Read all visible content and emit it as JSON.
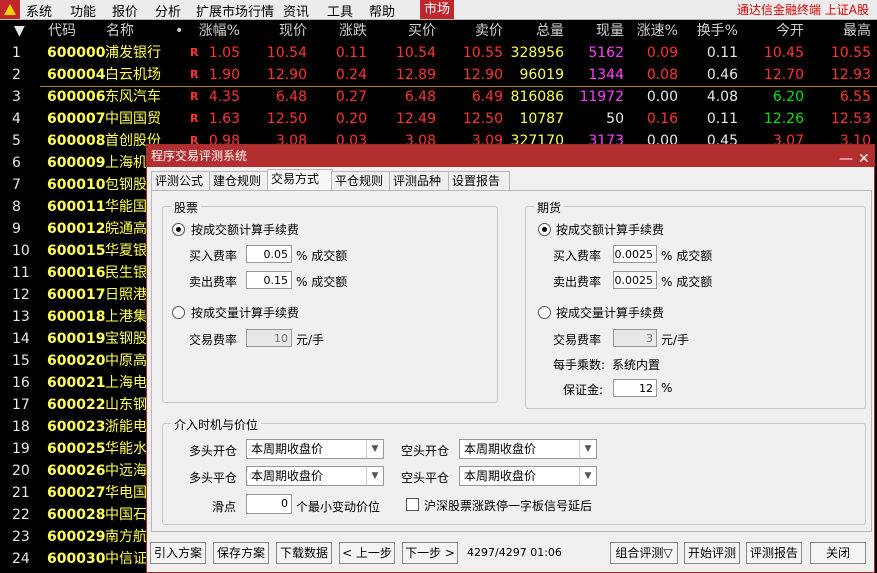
{
  "menu": {
    "items": [
      "系统",
      "功能",
      "报价",
      "分析",
      "扩展市场行情",
      "资讯",
      "工具",
      "帮助"
    ],
    "market_tab": "市场",
    "right_text": "通达信金融终端 上证A股"
  },
  "quote": {
    "sort_arrow": "▼",
    "headers": [
      "代码",
      "名称",
      "•",
      "涨幅%",
      "现价",
      "涨跌",
      "买价",
      "卖价",
      "总量",
      "现量",
      "涨速%",
      "换手%",
      "今开",
      "最高"
    ],
    "rows": [
      {
        "idx": "1",
        "code": "600000",
        "name": "浦发银行",
        "flag": "R",
        "chg_pct": "1.05",
        "price": "10.54",
        "chg": "0.11",
        "bid": "10.54",
        "ask": "10.55",
        "vol": "328956",
        "cur_vol": "5162",
        "speed": "0.09",
        "turn": "0.11",
        "open": "10.45",
        "high": "10.55"
      },
      {
        "idx": "2",
        "code": "600004",
        "name": "白云机场",
        "flag": "R",
        "chg_pct": "1.90",
        "price": "12.90",
        "chg": "0.24",
        "bid": "12.89",
        "ask": "12.90",
        "vol": "96019",
        "cur_vol": "1344",
        "speed": "0.08",
        "turn": "0.46",
        "open": "12.70",
        "high": "12.93"
      },
      {
        "idx": "3",
        "code": "600006",
        "name": "东风汽车",
        "flag": "R",
        "chg_pct": "4.35",
        "price": "6.48",
        "chg": "0.27",
        "bid": "6.48",
        "ask": "6.49",
        "vol": "816086",
        "cur_vol": "11972",
        "speed": "0.00",
        "turn": "4.08",
        "open": "6.20",
        "high": "6.55"
      },
      {
        "idx": "4",
        "code": "600007",
        "name": "中国国贸",
        "flag": "R",
        "chg_pct": "1.63",
        "price": "12.50",
        "chg": "0.20",
        "bid": "12.49",
        "ask": "12.50",
        "vol": "10787",
        "cur_vol": "50",
        "speed": "0.16",
        "turn": "0.11",
        "open": "12.26",
        "high": "12.53"
      },
      {
        "idx": "5",
        "code": "600008",
        "name": "首创股份",
        "flag": "R",
        "chg_pct": "0.98",
        "price": "3.08",
        "chg": "0.03",
        "bid": "3.08",
        "ask": "3.09",
        "vol": "327170",
        "cur_vol": "3173",
        "speed": "0.00",
        "turn": "0.45",
        "open": "3.07",
        "high": "3.10"
      },
      {
        "idx": "6",
        "code": "600009",
        "name": "上海机场"
      },
      {
        "idx": "7",
        "code": "600010",
        "name": "包钢股份"
      },
      {
        "idx": "8",
        "code": "600011",
        "name": "华能国际"
      },
      {
        "idx": "9",
        "code": "600012",
        "name": "皖通高速"
      },
      {
        "idx": "10",
        "code": "600015",
        "name": "华夏银行"
      },
      {
        "idx": "11",
        "code": "600016",
        "name": "民生银行"
      },
      {
        "idx": "12",
        "code": "600017",
        "name": "日照港"
      },
      {
        "idx": "13",
        "code": "600018",
        "name": "上港集团"
      },
      {
        "idx": "14",
        "code": "600019",
        "name": "宝钢股份"
      },
      {
        "idx": "15",
        "code": "600020",
        "name": "中原高速"
      },
      {
        "idx": "16",
        "code": "600021",
        "name": "上海电力"
      },
      {
        "idx": "17",
        "code": "600022",
        "name": "山东钢铁"
      },
      {
        "idx": "18",
        "code": "600023",
        "name": "浙能电力"
      },
      {
        "idx": "19",
        "code": "600025",
        "name": "华能水电"
      },
      {
        "idx": "20",
        "code": "600026",
        "name": "中远海能"
      },
      {
        "idx": "21",
        "code": "600027",
        "name": "华电国际"
      },
      {
        "idx": "22",
        "code": "600028",
        "name": "中国石化"
      },
      {
        "idx": "23",
        "code": "600029",
        "name": "南方航空"
      },
      {
        "idx": "24",
        "code": "600030",
        "name": "中信证券"
      }
    ]
  },
  "dialog": {
    "title": "程序交易评测系统",
    "minimize": "—",
    "close": "✕",
    "tabs": [
      "评测公式",
      "建仓规则",
      "交易方式",
      "平仓规则",
      "评测品种",
      "设置报告"
    ],
    "active_tab": "交易方式",
    "stock": {
      "group": "股票",
      "opt_amount": "按成交额计算手续费",
      "buy_label": "买入费率",
      "buy_rate": "0.05",
      "buy_unit": "% 成交额",
      "sell_label": "卖出费率",
      "sell_rate": "0.15",
      "sell_unit": "% 成交额",
      "opt_volume": "按成交量计算手续费",
      "fee_label": "交易费率",
      "fee_value": "10",
      "fee_unit": "元/手"
    },
    "futures": {
      "group": "期货",
      "opt_amount": "按成交额计算手续费",
      "buy_label": "买入费率",
      "buy_rate": "0.0025",
      "buy_unit": "% 成交额",
      "sell_label": "卖出费率",
      "sell_rate": "0.0025",
      "sell_unit": "% 成交额",
      "opt_volume": "按成交量计算手续费",
      "fee_label": "交易费率",
      "fee_value": "3",
      "fee_unit": "元/手",
      "mult_label": "每手乘数:",
      "mult_value": "系统内置",
      "margin_label": "保证金:",
      "margin_value": "12",
      "margin_unit": "%"
    },
    "timing": {
      "group": "介入时机与价位",
      "long_open_label": "多头开仓",
      "long_open_value": "本周期收盘价",
      "short_open_label": "空头开仓",
      "short_open_value": "本周期收盘价",
      "long_close_label": "多头平仓",
      "long_close_value": "本周期收盘价",
      "short_close_label": "空头平仓",
      "short_close_value": "本周期收盘价",
      "slip_label": "滑点",
      "slip_value": "0",
      "slip_unit": "个最小变动价位",
      "limit_check_label": "沪深股票涨跌停一字板信号延后"
    },
    "buttons": {
      "import": "引入方案",
      "save": "保存方案",
      "download": "下载数据",
      "prev": "< 上一步",
      "next": "下一步 >",
      "progress": "4297/4297 01:06",
      "combo": "组合评测▽",
      "start": "开始评测",
      "report": "评测报告",
      "close": "关闭"
    }
  },
  "colors": {
    "up": "#ff3232",
    "code": "#ffff54",
    "name": "#ffff54",
    "magenta": "#ff40ff",
    "green": "#00e600",
    "white": "#e8e8e8",
    "title_bar": "#b32e2e"
  }
}
